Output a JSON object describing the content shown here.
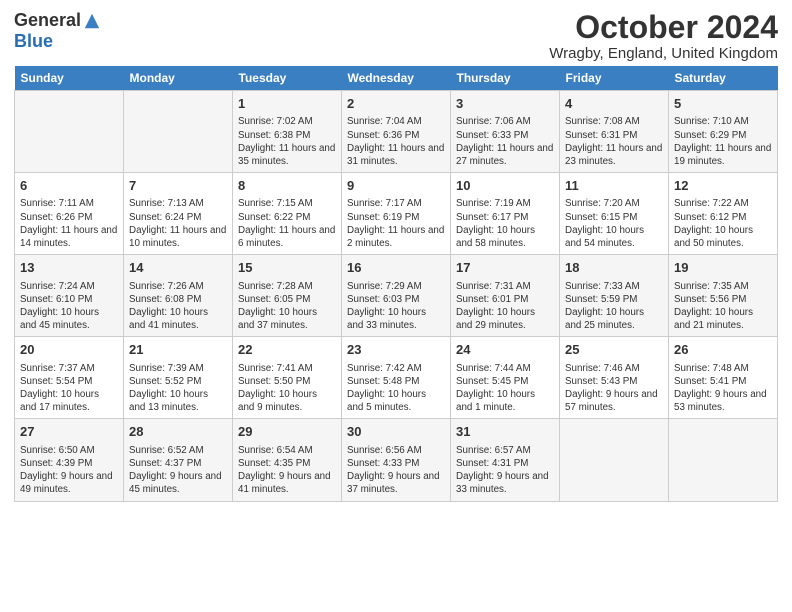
{
  "logo": {
    "general": "General",
    "blue": "Blue"
  },
  "title": "October 2024",
  "location": "Wragby, England, United Kingdom",
  "days_of_week": [
    "Sunday",
    "Monday",
    "Tuesday",
    "Wednesday",
    "Thursday",
    "Friday",
    "Saturday"
  ],
  "weeks": [
    [
      {
        "day": "",
        "sunrise": "",
        "sunset": "",
        "daylight": ""
      },
      {
        "day": "",
        "sunrise": "",
        "sunset": "",
        "daylight": ""
      },
      {
        "day": "1",
        "sunrise": "Sunrise: 7:02 AM",
        "sunset": "Sunset: 6:38 PM",
        "daylight": "Daylight: 11 hours and 35 minutes."
      },
      {
        "day": "2",
        "sunrise": "Sunrise: 7:04 AM",
        "sunset": "Sunset: 6:36 PM",
        "daylight": "Daylight: 11 hours and 31 minutes."
      },
      {
        "day": "3",
        "sunrise": "Sunrise: 7:06 AM",
        "sunset": "Sunset: 6:33 PM",
        "daylight": "Daylight: 11 hours and 27 minutes."
      },
      {
        "day": "4",
        "sunrise": "Sunrise: 7:08 AM",
        "sunset": "Sunset: 6:31 PM",
        "daylight": "Daylight: 11 hours and 23 minutes."
      },
      {
        "day": "5",
        "sunrise": "Sunrise: 7:10 AM",
        "sunset": "Sunset: 6:29 PM",
        "daylight": "Daylight: 11 hours and 19 minutes."
      }
    ],
    [
      {
        "day": "6",
        "sunrise": "Sunrise: 7:11 AM",
        "sunset": "Sunset: 6:26 PM",
        "daylight": "Daylight: 11 hours and 14 minutes."
      },
      {
        "day": "7",
        "sunrise": "Sunrise: 7:13 AM",
        "sunset": "Sunset: 6:24 PM",
        "daylight": "Daylight: 11 hours and 10 minutes."
      },
      {
        "day": "8",
        "sunrise": "Sunrise: 7:15 AM",
        "sunset": "Sunset: 6:22 PM",
        "daylight": "Daylight: 11 hours and 6 minutes."
      },
      {
        "day": "9",
        "sunrise": "Sunrise: 7:17 AM",
        "sunset": "Sunset: 6:19 PM",
        "daylight": "Daylight: 11 hours and 2 minutes."
      },
      {
        "day": "10",
        "sunrise": "Sunrise: 7:19 AM",
        "sunset": "Sunset: 6:17 PM",
        "daylight": "Daylight: 10 hours and 58 minutes."
      },
      {
        "day": "11",
        "sunrise": "Sunrise: 7:20 AM",
        "sunset": "Sunset: 6:15 PM",
        "daylight": "Daylight: 10 hours and 54 minutes."
      },
      {
        "day": "12",
        "sunrise": "Sunrise: 7:22 AM",
        "sunset": "Sunset: 6:12 PM",
        "daylight": "Daylight: 10 hours and 50 minutes."
      }
    ],
    [
      {
        "day": "13",
        "sunrise": "Sunrise: 7:24 AM",
        "sunset": "Sunset: 6:10 PM",
        "daylight": "Daylight: 10 hours and 45 minutes."
      },
      {
        "day": "14",
        "sunrise": "Sunrise: 7:26 AM",
        "sunset": "Sunset: 6:08 PM",
        "daylight": "Daylight: 10 hours and 41 minutes."
      },
      {
        "day": "15",
        "sunrise": "Sunrise: 7:28 AM",
        "sunset": "Sunset: 6:05 PM",
        "daylight": "Daylight: 10 hours and 37 minutes."
      },
      {
        "day": "16",
        "sunrise": "Sunrise: 7:29 AM",
        "sunset": "Sunset: 6:03 PM",
        "daylight": "Daylight: 10 hours and 33 minutes."
      },
      {
        "day": "17",
        "sunrise": "Sunrise: 7:31 AM",
        "sunset": "Sunset: 6:01 PM",
        "daylight": "Daylight: 10 hours and 29 minutes."
      },
      {
        "day": "18",
        "sunrise": "Sunrise: 7:33 AM",
        "sunset": "Sunset: 5:59 PM",
        "daylight": "Daylight: 10 hours and 25 minutes."
      },
      {
        "day": "19",
        "sunrise": "Sunrise: 7:35 AM",
        "sunset": "Sunset: 5:56 PM",
        "daylight": "Daylight: 10 hours and 21 minutes."
      }
    ],
    [
      {
        "day": "20",
        "sunrise": "Sunrise: 7:37 AM",
        "sunset": "Sunset: 5:54 PM",
        "daylight": "Daylight: 10 hours and 17 minutes."
      },
      {
        "day": "21",
        "sunrise": "Sunrise: 7:39 AM",
        "sunset": "Sunset: 5:52 PM",
        "daylight": "Daylight: 10 hours and 13 minutes."
      },
      {
        "day": "22",
        "sunrise": "Sunrise: 7:41 AM",
        "sunset": "Sunset: 5:50 PM",
        "daylight": "Daylight: 10 hours and 9 minutes."
      },
      {
        "day": "23",
        "sunrise": "Sunrise: 7:42 AM",
        "sunset": "Sunset: 5:48 PM",
        "daylight": "Daylight: 10 hours and 5 minutes."
      },
      {
        "day": "24",
        "sunrise": "Sunrise: 7:44 AM",
        "sunset": "Sunset: 5:45 PM",
        "daylight": "Daylight: 10 hours and 1 minute."
      },
      {
        "day": "25",
        "sunrise": "Sunrise: 7:46 AM",
        "sunset": "Sunset: 5:43 PM",
        "daylight": "Daylight: 9 hours and 57 minutes."
      },
      {
        "day": "26",
        "sunrise": "Sunrise: 7:48 AM",
        "sunset": "Sunset: 5:41 PM",
        "daylight": "Daylight: 9 hours and 53 minutes."
      }
    ],
    [
      {
        "day": "27",
        "sunrise": "Sunrise: 6:50 AM",
        "sunset": "Sunset: 4:39 PM",
        "daylight": "Daylight: 9 hours and 49 minutes."
      },
      {
        "day": "28",
        "sunrise": "Sunrise: 6:52 AM",
        "sunset": "Sunset: 4:37 PM",
        "daylight": "Daylight: 9 hours and 45 minutes."
      },
      {
        "day": "29",
        "sunrise": "Sunrise: 6:54 AM",
        "sunset": "Sunset: 4:35 PM",
        "daylight": "Daylight: 9 hours and 41 minutes."
      },
      {
        "day": "30",
        "sunrise": "Sunrise: 6:56 AM",
        "sunset": "Sunset: 4:33 PM",
        "daylight": "Daylight: 9 hours and 37 minutes."
      },
      {
        "day": "31",
        "sunrise": "Sunrise: 6:57 AM",
        "sunset": "Sunset: 4:31 PM",
        "daylight": "Daylight: 9 hours and 33 minutes."
      },
      {
        "day": "",
        "sunrise": "",
        "sunset": "",
        "daylight": ""
      },
      {
        "day": "",
        "sunrise": "",
        "sunset": "",
        "daylight": ""
      }
    ]
  ]
}
